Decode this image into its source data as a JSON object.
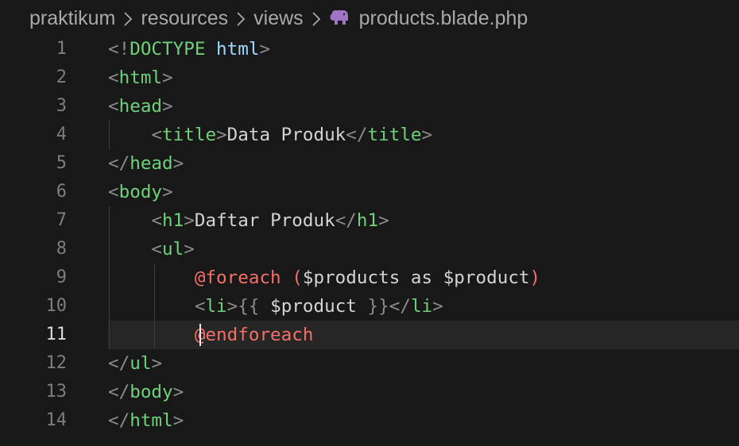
{
  "breadcrumb": {
    "items": [
      "praktikum",
      "resources",
      "views"
    ],
    "file": "products.blade.php",
    "file_icon": "php-elephant-icon"
  },
  "editor": {
    "current_line": 11,
    "lines": [
      {
        "n": "1",
        "tokens": [
          {
            "c": "p",
            "t": "<!"
          },
          {
            "c": "t",
            "t": "DOCTYPE"
          },
          {
            "c": "v",
            "t": " "
          },
          {
            "c": "a",
            "t": "html"
          },
          {
            "c": "p",
            "t": ">"
          }
        ]
      },
      {
        "n": "2",
        "tokens": [
          {
            "c": "p",
            "t": "<"
          },
          {
            "c": "t",
            "t": "html"
          },
          {
            "c": "p",
            "t": ">"
          }
        ]
      },
      {
        "n": "3",
        "tokens": [
          {
            "c": "p",
            "t": "<"
          },
          {
            "c": "t",
            "t": "head"
          },
          {
            "c": "p",
            "t": ">"
          }
        ]
      },
      {
        "n": "4",
        "tokens": [
          {
            "c": "v",
            "t": "    "
          },
          {
            "c": "p",
            "t": "<"
          },
          {
            "c": "t",
            "t": "title"
          },
          {
            "c": "p",
            "t": ">"
          },
          {
            "c": "v",
            "t": "Data Produk"
          },
          {
            "c": "p",
            "t": "</"
          },
          {
            "c": "t",
            "t": "title"
          },
          {
            "c": "p",
            "t": ">"
          }
        ]
      },
      {
        "n": "5",
        "tokens": [
          {
            "c": "p",
            "t": "</"
          },
          {
            "c": "t",
            "t": "head"
          },
          {
            "c": "p",
            "t": ">"
          }
        ]
      },
      {
        "n": "6",
        "tokens": [
          {
            "c": "p",
            "t": "<"
          },
          {
            "c": "t",
            "t": "body"
          },
          {
            "c": "p",
            "t": ">"
          }
        ]
      },
      {
        "n": "7",
        "tokens": [
          {
            "c": "v",
            "t": "    "
          },
          {
            "c": "p",
            "t": "<"
          },
          {
            "c": "t",
            "t": "h1"
          },
          {
            "c": "p",
            "t": ">"
          },
          {
            "c": "v",
            "t": "Daftar Produk"
          },
          {
            "c": "p",
            "t": "</"
          },
          {
            "c": "t",
            "t": "h1"
          },
          {
            "c": "p",
            "t": ">"
          }
        ]
      },
      {
        "n": "8",
        "tokens": [
          {
            "c": "v",
            "t": "    "
          },
          {
            "c": "p",
            "t": "<"
          },
          {
            "c": "t",
            "t": "ul"
          },
          {
            "c": "p",
            "t": ">"
          }
        ]
      },
      {
        "n": "9",
        "tokens": [
          {
            "c": "v",
            "t": "        "
          },
          {
            "c": "k",
            "t": "@foreach"
          },
          {
            "c": "v",
            "t": " "
          },
          {
            "c": "k",
            "t": "("
          },
          {
            "c": "v",
            "t": "$products as $product"
          },
          {
            "c": "k",
            "t": ")"
          }
        ]
      },
      {
        "n": "10",
        "tokens": [
          {
            "c": "v",
            "t": "        "
          },
          {
            "c": "p",
            "t": "<"
          },
          {
            "c": "t",
            "t": "li"
          },
          {
            "c": "p",
            "t": ">"
          },
          {
            "c": "p",
            "t": "{{"
          },
          {
            "c": "v",
            "t": " $product "
          },
          {
            "c": "p",
            "t": "}}"
          },
          {
            "c": "p",
            "t": "</"
          },
          {
            "c": "t",
            "t": "li"
          },
          {
            "c": "p",
            "t": ">"
          }
        ]
      },
      {
        "n": "11",
        "tokens": [
          {
            "c": "v",
            "t": "        "
          },
          {
            "c": "k",
            "t": "@endforeach"
          }
        ]
      },
      {
        "n": "12",
        "tokens": [
          {
            "c": "p",
            "t": "</"
          },
          {
            "c": "t",
            "t": "ul"
          },
          {
            "c": "p",
            "t": ">"
          }
        ]
      },
      {
        "n": "13",
        "tokens": [
          {
            "c": "p",
            "t": "</"
          },
          {
            "c": "t",
            "t": "body"
          },
          {
            "c": "p",
            "t": ">"
          }
        ]
      },
      {
        "n": "14",
        "tokens": [
          {
            "c": "p",
            "t": "</"
          },
          {
            "c": "t",
            "t": "html"
          },
          {
            "c": "p",
            "t": ">"
          }
        ]
      }
    ]
  },
  "colors": {
    "background": "#181818",
    "tag": "#6fd27a",
    "punctuation": "#8b8b8b",
    "attribute": "#9cdcfe",
    "blade_directive": "#f47067",
    "text": "#d4d4d4",
    "php_icon": "#a074c4"
  }
}
